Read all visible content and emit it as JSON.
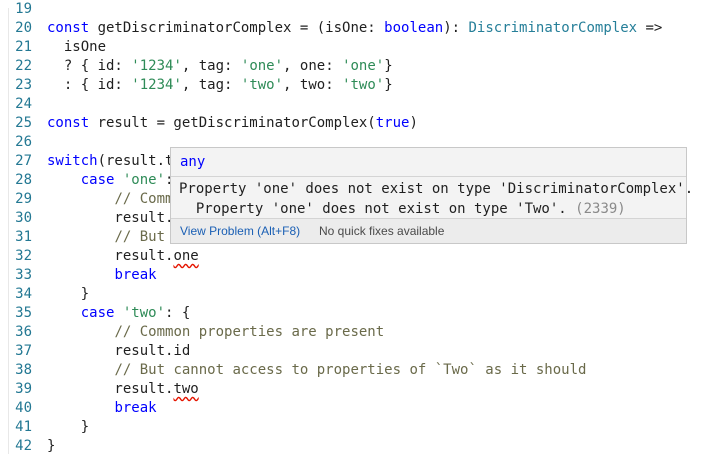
{
  "lines": [
    {
      "n": "19",
      "segs": []
    },
    {
      "n": "20",
      "segs": [
        [
          "kw",
          "const "
        ],
        [
          "id",
          "getDiscriminatorComplex = ("
        ],
        [
          "id",
          "isOne: "
        ],
        [
          "kw",
          "boolean"
        ],
        [
          "id",
          "): "
        ],
        [
          "type",
          "DiscriminatorComplex"
        ],
        [
          "id",
          " =>"
        ]
      ]
    },
    {
      "n": "21",
      "segs": [
        [
          "id",
          "  isOne"
        ]
      ]
    },
    {
      "n": "22",
      "segs": [
        [
          "id",
          "  ? { id: "
        ],
        [
          "str",
          "'1234'"
        ],
        [
          "id",
          ", tag: "
        ],
        [
          "str",
          "'one'"
        ],
        [
          "id",
          ", one: "
        ],
        [
          "str",
          "'one'"
        ],
        [
          "id",
          "}"
        ]
      ]
    },
    {
      "n": "23",
      "segs": [
        [
          "id",
          "  : { id: "
        ],
        [
          "str",
          "'1234'"
        ],
        [
          "id",
          ", tag: "
        ],
        [
          "str",
          "'two'"
        ],
        [
          "id",
          ", two: "
        ],
        [
          "str",
          "'two'"
        ],
        [
          "id",
          "}"
        ]
      ]
    },
    {
      "n": "24",
      "segs": []
    },
    {
      "n": "25",
      "segs": [
        [
          "kw",
          "const "
        ],
        [
          "id",
          "result = getDiscriminatorComplex("
        ],
        [
          "kw",
          "true"
        ],
        [
          "id",
          ")"
        ]
      ]
    },
    {
      "n": "26",
      "segs": []
    },
    {
      "n": "27",
      "segs": [
        [
          "kw",
          "switch"
        ],
        [
          "id",
          "(result.t"
        ]
      ]
    },
    {
      "n": "28",
      "segs": [
        [
          "id",
          "    "
        ],
        [
          "kw",
          "case "
        ],
        [
          "str",
          "'one'"
        ],
        [
          "id",
          ":"
        ]
      ]
    },
    {
      "n": "29",
      "segs": [
        [
          "id",
          "        "
        ],
        [
          "cmt",
          "// Comm"
        ]
      ]
    },
    {
      "n": "30",
      "segs": [
        [
          "id",
          "        result."
        ]
      ]
    },
    {
      "n": "31",
      "segs": [
        [
          "id",
          "        "
        ],
        [
          "cmt",
          "// But"
        ]
      ]
    },
    {
      "n": "32",
      "segs": [
        [
          "id",
          "        result."
        ],
        [
          "sq",
          "one"
        ]
      ]
    },
    {
      "n": "33",
      "segs": [
        [
          "id",
          "        "
        ],
        [
          "kw",
          "break"
        ]
      ]
    },
    {
      "n": "34",
      "segs": [
        [
          "id",
          "    }"
        ]
      ]
    },
    {
      "n": "35",
      "segs": [
        [
          "id",
          "    "
        ],
        [
          "kw",
          "case "
        ],
        [
          "str",
          "'two'"
        ],
        [
          "id",
          ": {"
        ]
      ]
    },
    {
      "n": "36",
      "segs": [
        [
          "id",
          "        "
        ],
        [
          "cmt",
          "// Common properties are present"
        ]
      ]
    },
    {
      "n": "37",
      "segs": [
        [
          "id",
          "        result.id"
        ]
      ]
    },
    {
      "n": "38",
      "segs": [
        [
          "id",
          "        "
        ],
        [
          "cmt",
          "// But cannot access to properties of `Two` as it should"
        ]
      ]
    },
    {
      "n": "39",
      "segs": [
        [
          "id",
          "        result."
        ],
        [
          "sq",
          "two"
        ]
      ]
    },
    {
      "n": "40",
      "segs": [
        [
          "id",
          "        "
        ],
        [
          "kw",
          "break"
        ]
      ]
    },
    {
      "n": "41",
      "segs": [
        [
          "id",
          "    }"
        ]
      ]
    },
    {
      "n": "42",
      "segs": [
        [
          "id",
          "}"
        ]
      ]
    }
  ],
  "hover": {
    "type": "any",
    "message_line1": "Property 'one' does not exist on type 'DiscriminatorComplex'.",
    "message_line2": "  Property 'one' does not exist on type 'Two'. ",
    "error_code": "(2339)",
    "view_problem": "View Problem (Alt+F8)",
    "no_fixes": "No quick fixes available"
  }
}
